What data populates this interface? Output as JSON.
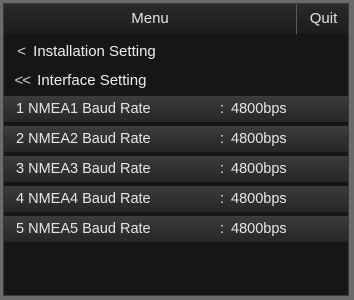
{
  "header": {
    "title": "Menu",
    "quit_label": "Quit"
  },
  "breadcrumbs": [
    {
      "icon": "chevron-left-icon",
      "glyph": "<",
      "label": "Installation Setting"
    },
    {
      "icon": "double-chevron-left-icon",
      "glyph": "<<",
      "label": "Interface Setting"
    }
  ],
  "settings": [
    {
      "label": "1 NMEA1 Baud Rate",
      "separator": ":",
      "value": "4800bps"
    },
    {
      "label": "2 NMEA2 Baud Rate",
      "separator": ":",
      "value": "4800bps"
    },
    {
      "label": "3 NMEA3 Baud Rate",
      "separator": ":",
      "value": "4800bps"
    },
    {
      "label": "4 NMEA4 Baud Rate",
      "separator": ":",
      "value": "4800bps"
    },
    {
      "label": "5 NMEA5 Baud Rate",
      "separator": ":",
      "value": "4800bps"
    }
  ]
}
